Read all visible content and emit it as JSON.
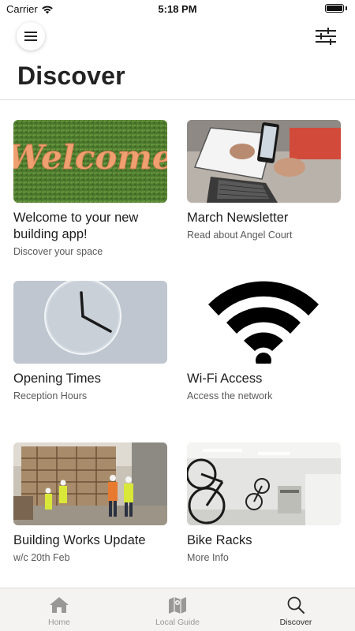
{
  "status_bar": {
    "carrier": "Carrier",
    "time": "5:18 PM"
  },
  "header": {
    "title": "Discover",
    "menu_icon": "hamburger-icon",
    "filter_icon": "sliders-icon"
  },
  "cards": [
    {
      "title": "Welcome to your new building app!",
      "subtitle": "Discover your space",
      "image_text": "Welcome",
      "image": "welcome-sign-on-grass"
    },
    {
      "title": "March Newsletter",
      "subtitle": "Read about Angel Court",
      "image": "laptop-and-phone"
    },
    {
      "title": "Opening Times",
      "subtitle": "Reception Hours",
      "image": "wall-clock"
    },
    {
      "title": "Wi-Fi Access",
      "subtitle": "Access the network",
      "image": "wifi-symbol"
    },
    {
      "title": "Building Works Update",
      "subtitle": "w/c 20th Feb",
      "image": "construction-site"
    },
    {
      "title": "Bike Racks",
      "subtitle": "More Info",
      "image": "bike-storage-room"
    }
  ],
  "tabs": [
    {
      "label": "Home",
      "icon": "home-icon",
      "active": false
    },
    {
      "label": "Local Guide",
      "icon": "map-icon",
      "active": false
    },
    {
      "label": "Discover",
      "icon": "search-icon",
      "active": true
    }
  ],
  "colors": {
    "tab_bar_bg": "#f4f3f1",
    "tab_active": "#2a2a2a",
    "tab_inactive": "#9a9896",
    "welcome_text": "#f0a070"
  }
}
